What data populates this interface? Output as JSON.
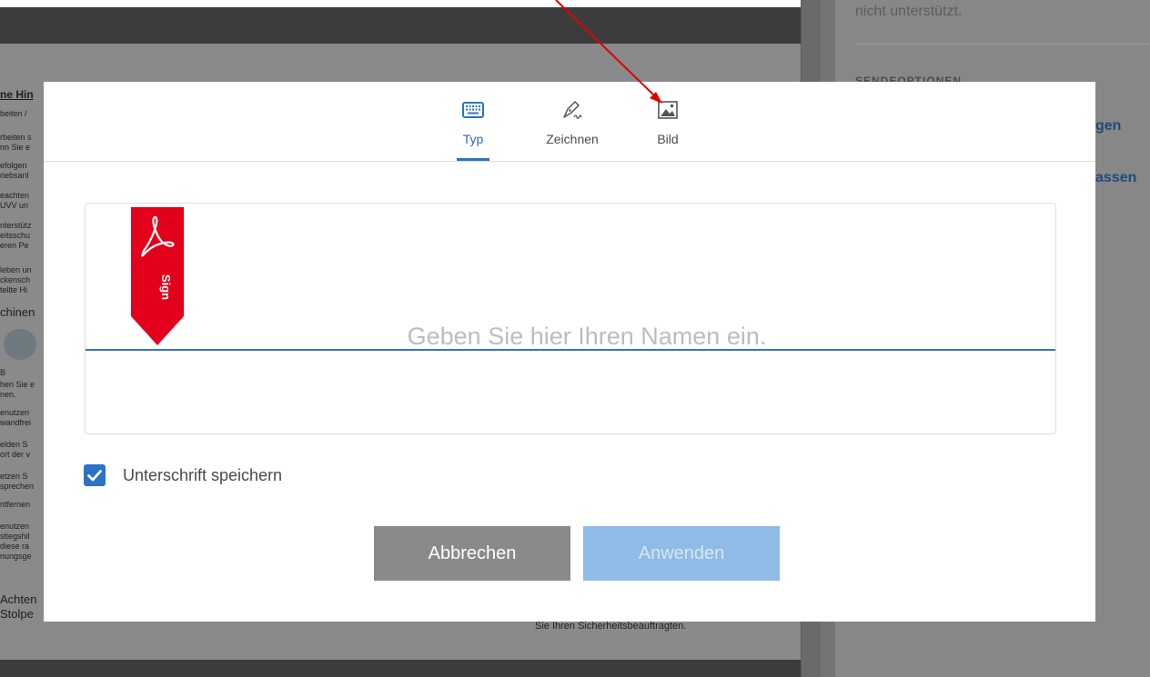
{
  "background": {
    "right_panel": {
      "top_text": "nicht unterstützt.",
      "section_heading": "SENDEOPTIONEN",
      "link_1": "gen",
      "link_2": "assen"
    },
    "document_snippets": {
      "heading": "ne Hin",
      "lines": [
        "beiten /",
        "rbeiten s",
        "nn Sie e",
        "efolgen",
        "riebsanl",
        "eachten",
        "UVV un",
        "nterstütz",
        "eitsschu",
        "eren Pe",
        "leben un",
        "ckensch",
        "tellte Hi"
      ],
      "section": "chinen",
      "lines_2": [
        "B",
        "hen Sie e",
        "nen.",
        "enutzen",
        "wandfrei",
        "elden S",
        "ort der v",
        "etzen S",
        "sprechen",
        "ntfernen",
        "enutzen",
        "stiegshil",
        "diese ra",
        "nungsge"
      ],
      "bottom_big": [
        "Achten",
        "Stolpe"
      ],
      "bottom_text": "Sie Ihren Sicherheitsbeauftragten."
    }
  },
  "dialog": {
    "tabs": [
      {
        "label": "Typ",
        "icon": "keyboard-icon",
        "active": true
      },
      {
        "label": "Zeichnen",
        "icon": "pen-signature-icon",
        "active": false
      },
      {
        "label": "Bild",
        "icon": "image-icon",
        "active": false
      }
    ],
    "signature": {
      "placeholder": "Geben Sie hier Ihren Namen ein.",
      "value": ""
    },
    "ribbon": {
      "text": "Sign",
      "icon": "adobe-acrobat-icon",
      "color": "#e2001a"
    },
    "save_checkbox": {
      "checked": true,
      "label": "Unterschrift speichern"
    },
    "buttons": {
      "cancel": "Abbrechen",
      "apply": "Anwenden"
    }
  },
  "colors": {
    "accent": "#2b74c3",
    "apply_disabled": "#8fbbe6",
    "cancel": "#8a8a8a",
    "overlay_arrow": "#e00000"
  }
}
